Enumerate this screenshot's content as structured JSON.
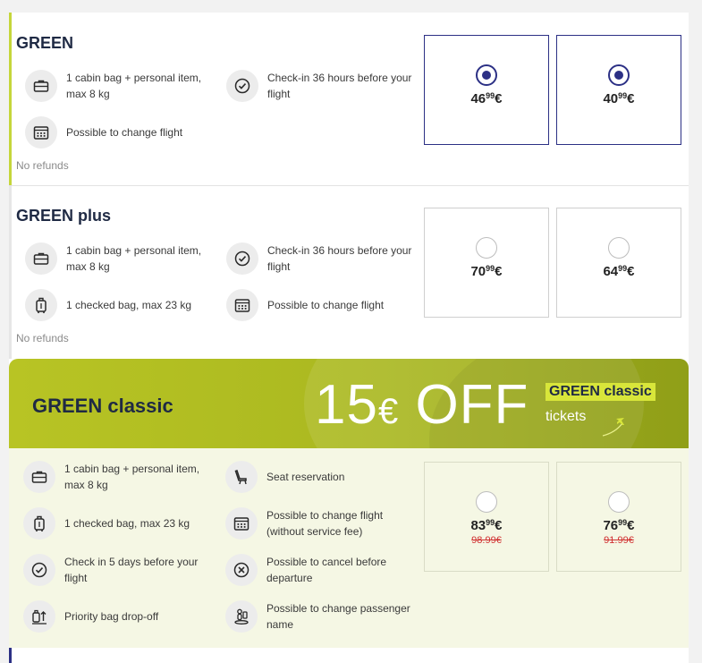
{
  "fares": [
    {
      "title": "GREEN",
      "features": [
        {
          "icon": "briefcase-icon",
          "text": "1 cabin bag + personal item, max 8 kg"
        },
        {
          "icon": "check-circle-icon",
          "text": "Check-in 36 hours before your flight"
        },
        {
          "icon": "calendar-icon",
          "text": "Possible to change flight"
        }
      ],
      "note": "No refunds",
      "prices": [
        {
          "main": "46",
          "cents": "99",
          "currency": "€",
          "selected": true
        },
        {
          "main": "40",
          "cents": "99",
          "currency": "€",
          "selected": true
        }
      ]
    },
    {
      "title": "GREEN plus",
      "features": [
        {
          "icon": "briefcase-icon",
          "text": "1 cabin bag + personal item, max 8 kg"
        },
        {
          "icon": "check-circle-icon",
          "text": "Check-in 36 hours before your flight"
        },
        {
          "icon": "luggage-icon",
          "text": "1 checked bag, max 23 kg"
        },
        {
          "icon": "calendar-icon",
          "text": "Possible to change flight"
        }
      ],
      "note": "No refunds",
      "prices": [
        {
          "main": "70",
          "cents": "99",
          "currency": "€",
          "selected": false
        },
        {
          "main": "64",
          "cents": "99",
          "currency": "€",
          "selected": false
        }
      ]
    }
  ],
  "classic": {
    "title": "GREEN classic",
    "banner": {
      "amount": "15",
      "currency": "€",
      "off": "OFF",
      "tag": "GREEN classic",
      "sub": "tickets"
    },
    "features": [
      {
        "icon": "briefcase-icon",
        "text": "1 cabin bag + personal item, max 8 kg"
      },
      {
        "icon": "seat-icon",
        "text": "Seat reservation"
      },
      {
        "icon": "luggage-icon",
        "text": "1 checked bag, max 23 kg"
      },
      {
        "icon": "calendar-icon",
        "text": "Possible to change flight (without service fee)"
      },
      {
        "icon": "check-circle-icon",
        "text": "Check in 5 days before your flight"
      },
      {
        "icon": "cancel-circle-icon",
        "text": "Possible to cancel before departure"
      },
      {
        "icon": "bag-dropoff-icon",
        "text": "Priority bag drop-off"
      },
      {
        "icon": "passenger-name-icon",
        "text": "Possible to change passenger name"
      }
    ],
    "prices": [
      {
        "main": "83",
        "cents": "99",
        "currency": "€",
        "old": "98.99€",
        "selected": false
      },
      {
        "main": "76",
        "cents": "99",
        "currency": "€",
        "old": "91.99€",
        "selected": false
      }
    ]
  },
  "colors": {
    "brand_navy": "#2c3085",
    "accent_green": "#c5d63a",
    "banner_olive": "#aab820",
    "strike_red": "#d03030"
  }
}
